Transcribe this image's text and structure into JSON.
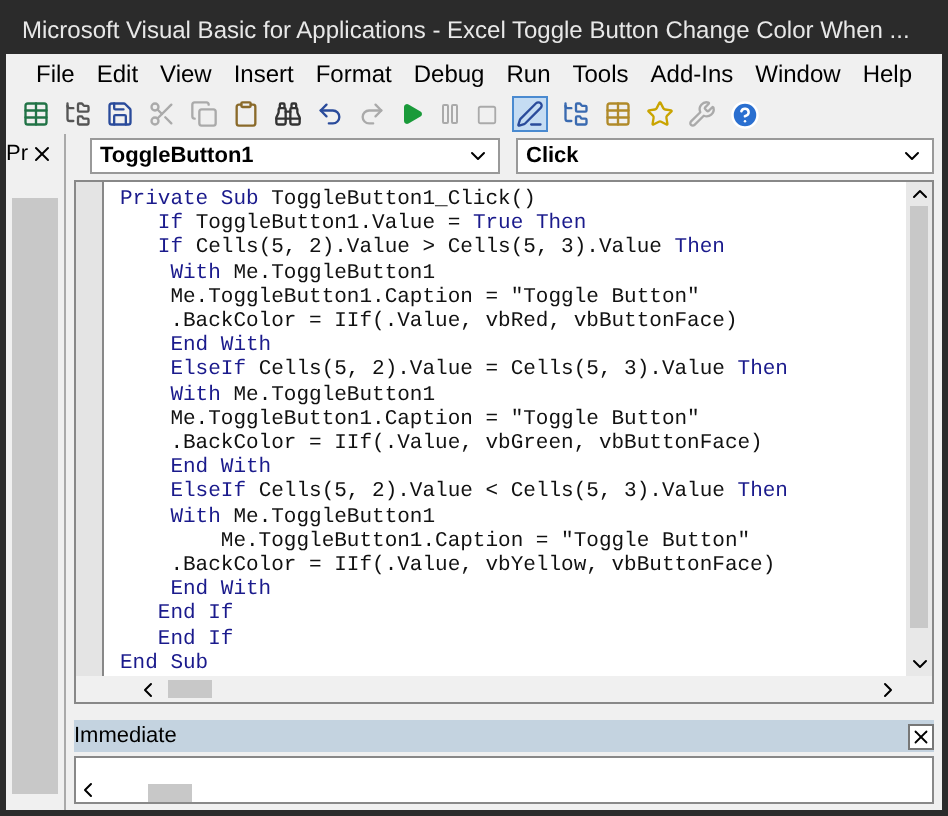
{
  "window": {
    "title": "Microsoft Visual Basic for Applications - Excel Toggle Button Change Color When ..."
  },
  "menu": [
    "File",
    "Edit",
    "View",
    "Insert",
    "Format",
    "Debug",
    "Run",
    "Tools",
    "Add-Ins",
    "Window",
    "Help"
  ],
  "project_panel": {
    "title": "Pr"
  },
  "object_dropdown": {
    "value": "ToggleButton1"
  },
  "procedure_dropdown": {
    "value": "Click"
  },
  "code_lines": [
    [
      {
        "text": "Private Sub",
        "kind": "keyword"
      },
      {
        "text": " ToggleButton1_Click()",
        "kind": "plain"
      }
    ],
    [
      {
        "text": "   If",
        "kind": "keyword"
      },
      {
        "text": " ToggleButton1.Value = ",
        "kind": "plain"
      },
      {
        "text": "True Then",
        "kind": "keyword"
      }
    ],
    [
      {
        "text": "   If",
        "kind": "keyword"
      },
      {
        "text": " Cells(5, 2).Value > Cells(5, 3).Value ",
        "kind": "plain"
      },
      {
        "text": "Then",
        "kind": "keyword"
      }
    ],
    [
      {
        "text": "    With",
        "kind": "keyword"
      },
      {
        "text": " Me.ToggleButton1",
        "kind": "plain"
      }
    ],
    [
      {
        "text": "    Me.ToggleButton1.Caption = \"Toggle Button\"",
        "kind": "plain"
      }
    ],
    [
      {
        "text": "    .BackColor = IIf(.Value, vbRed, vbButtonFace)",
        "kind": "plain"
      }
    ],
    [
      {
        "text": "    End With",
        "kind": "keyword"
      }
    ],
    [
      {
        "text": "    ElseIf",
        "kind": "keyword"
      },
      {
        "text": " Cells(5, 2).Value = Cells(5, 3).Value ",
        "kind": "plain"
      },
      {
        "text": "Then",
        "kind": "keyword"
      }
    ],
    [
      {
        "text": "    With",
        "kind": "keyword"
      },
      {
        "text": " Me.ToggleButton1",
        "kind": "plain"
      }
    ],
    [
      {
        "text": "    Me.ToggleButton1.Caption = \"Toggle Button\"",
        "kind": "plain"
      }
    ],
    [
      {
        "text": "    .BackColor = IIf(.Value, vbGreen, vbButtonFace)",
        "kind": "plain"
      }
    ],
    [
      {
        "text": "    End With",
        "kind": "keyword"
      }
    ],
    [
      {
        "text": "    ElseIf",
        "kind": "keyword"
      },
      {
        "text": " Cells(5, 2).Value < Cells(5, 3).Value ",
        "kind": "plain"
      },
      {
        "text": "Then",
        "kind": "keyword"
      }
    ],
    [
      {
        "text": "    With",
        "kind": "keyword"
      },
      {
        "text": " Me.ToggleButton1",
        "kind": "plain"
      }
    ],
    [
      {
        "text": "        Me.ToggleButton1.Caption = \"Toggle Button\"",
        "kind": "plain"
      }
    ],
    [
      {
        "text": "    .BackColor = IIf(.Value, vbYellow, vbButtonFace)",
        "kind": "plain"
      }
    ],
    [
      {
        "text": "    End With",
        "kind": "keyword"
      }
    ],
    [
      {
        "text": "   End If",
        "kind": "keyword"
      }
    ],
    [
      {
        "text": "   End If",
        "kind": "keyword"
      }
    ],
    [
      {
        "text": "End Sub",
        "kind": "keyword"
      }
    ]
  ],
  "immediate": {
    "title": "Immediate"
  }
}
